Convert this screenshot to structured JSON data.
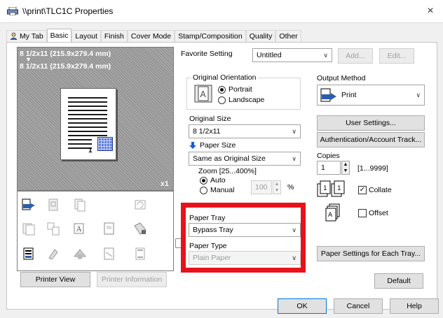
{
  "window": {
    "title": "\\\\print\\TLC1C Properties",
    "close_glyph": "×"
  },
  "tabs": [
    {
      "label": "My Tab"
    },
    {
      "label": "Basic"
    },
    {
      "label": "Layout"
    },
    {
      "label": "Finish"
    },
    {
      "label": "Cover Mode"
    },
    {
      "label": "Stamp/Composition"
    },
    {
      "label": "Quality"
    },
    {
      "label": "Other"
    }
  ],
  "preview": {
    "line1": "8 1/2x11 (215.9x279.4 mm)",
    "arrow": "▼",
    "line2": "8 1/2x11 (215.9x279.4 mm)",
    "copies_badge": "x1",
    "tray_number": "1"
  },
  "buttons": {
    "printer_view": "Printer View",
    "printer_information": "Printer Information",
    "add": "Add...",
    "edit": "Edit...",
    "user_settings": "User Settings...",
    "authentication": "Authentication/Account Track...",
    "paper_settings_each_tray": "Paper Settings for Each Tray...",
    "default": "Default",
    "ok": "OK",
    "cancel": "Cancel",
    "help": "Help"
  },
  "favorite_setting": {
    "label": "Favorite Setting",
    "value": "Untitled"
  },
  "original_orientation": {
    "label": "Original Orientation",
    "options": [
      "Portrait",
      "Landscape"
    ],
    "selected": "Portrait"
  },
  "original_size": {
    "label": "Original Size",
    "value": "8 1/2x11"
  },
  "paper_size": {
    "label": "Paper Size",
    "value": "Same as Original Size"
  },
  "zoom": {
    "label": "Zoom [25...400%]",
    "options": [
      "Auto",
      "Manual"
    ],
    "selected": "Auto",
    "value": "100",
    "unit": "%"
  },
  "paper_tray": {
    "label": "Paper Tray",
    "value": "Bypass Tray"
  },
  "paper_type": {
    "label": "Paper Type",
    "value": "Plain Paper"
  },
  "output_method": {
    "label": "Output Method",
    "value": "Print"
  },
  "copies": {
    "label": "Copies",
    "value": "1",
    "range": "[1...9999]"
  },
  "collate": {
    "label": "Collate",
    "checked": true
  },
  "offset": {
    "label": "Offset",
    "checked": false
  },
  "colors": {
    "highlight_box": "#e8121c",
    "preview_bg": "#9a9a9a"
  }
}
